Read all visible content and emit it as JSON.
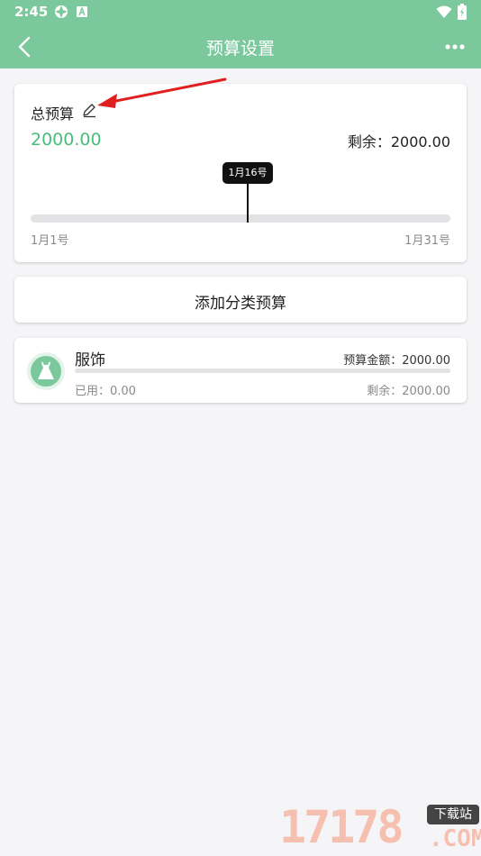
{
  "status_bar": {
    "time": "2:45"
  },
  "app_bar": {
    "title": "预算设置"
  },
  "total_budget": {
    "label": "总预算",
    "amount": "2000.00",
    "remaining": "剩余：2000.00",
    "today_marker": "1月16号",
    "start_date": "1月1号",
    "end_date": "1月31号"
  },
  "add_category": {
    "label": "添加分类预算"
  },
  "categories": [
    {
      "name": "服饰",
      "icon": "dress-icon",
      "budget": "预算金额：2000.00",
      "used": "已用：0.00",
      "remaining": "剩余：2000.00"
    }
  ],
  "watermark": {
    "number": "17178",
    "badge": "下载站",
    "suffix": ".COM"
  },
  "colors": {
    "primary": "#7ac89c",
    "amount_green": "#49bd7a",
    "annotation_red": "#e02020",
    "background": "#f5f5f7"
  }
}
